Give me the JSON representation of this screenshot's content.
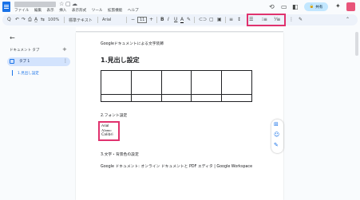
{
  "app": {
    "doc_title": "",
    "menu": [
      "ファイル",
      "編集",
      "表示",
      "挿入",
      "表示形式",
      "ツール",
      "拡張機能",
      "ヘルプ"
    ],
    "share_label": "共有",
    "icons": [
      "docs-icon",
      "star-icon",
      "move-icon",
      "cloud-icon",
      "history-icon",
      "comment-icon",
      "video-icon",
      "gemini-icon"
    ]
  },
  "toolbar": {
    "zoom": "100%",
    "style": "標準テキスト",
    "font": "Arial",
    "font_size": "11",
    "items_left": [
      "Q",
      "↶",
      "↷",
      "⎙",
      "A̲",
      "⇆"
    ],
    "bold": "B",
    "italic": "I",
    "underline": "U",
    "textcolor": "A",
    "more": "⋮",
    "highlight_group_note": "line-spacing / list controls highlighted in pink",
    "highlight_color": "#e0326e"
  },
  "left_panel": {
    "heading": "ドキュメント タブ",
    "add": "+",
    "tab_label": "タブ 1",
    "tab_more": "⋮",
    "outline_item": "1.見出し設定"
  },
  "document": {
    "intro": "Googleドキュメントによる文字装飾",
    "heading1": "1.見出し設定",
    "table": {
      "rows": 2,
      "cols": 5
    },
    "section2": "2.フォント設定",
    "fonts": [
      "Arial",
      "Alamo",
      "Calibri"
    ],
    "section3": "3.文字・背景色の設定",
    "footer_text": "Google ドキュメント: オンライン ドキュメントと PDF エディタ | Google Workspace"
  },
  "side_icons": [
    "add-comment-icon",
    "emoji-icon",
    "suggest-edit-icon"
  ]
}
